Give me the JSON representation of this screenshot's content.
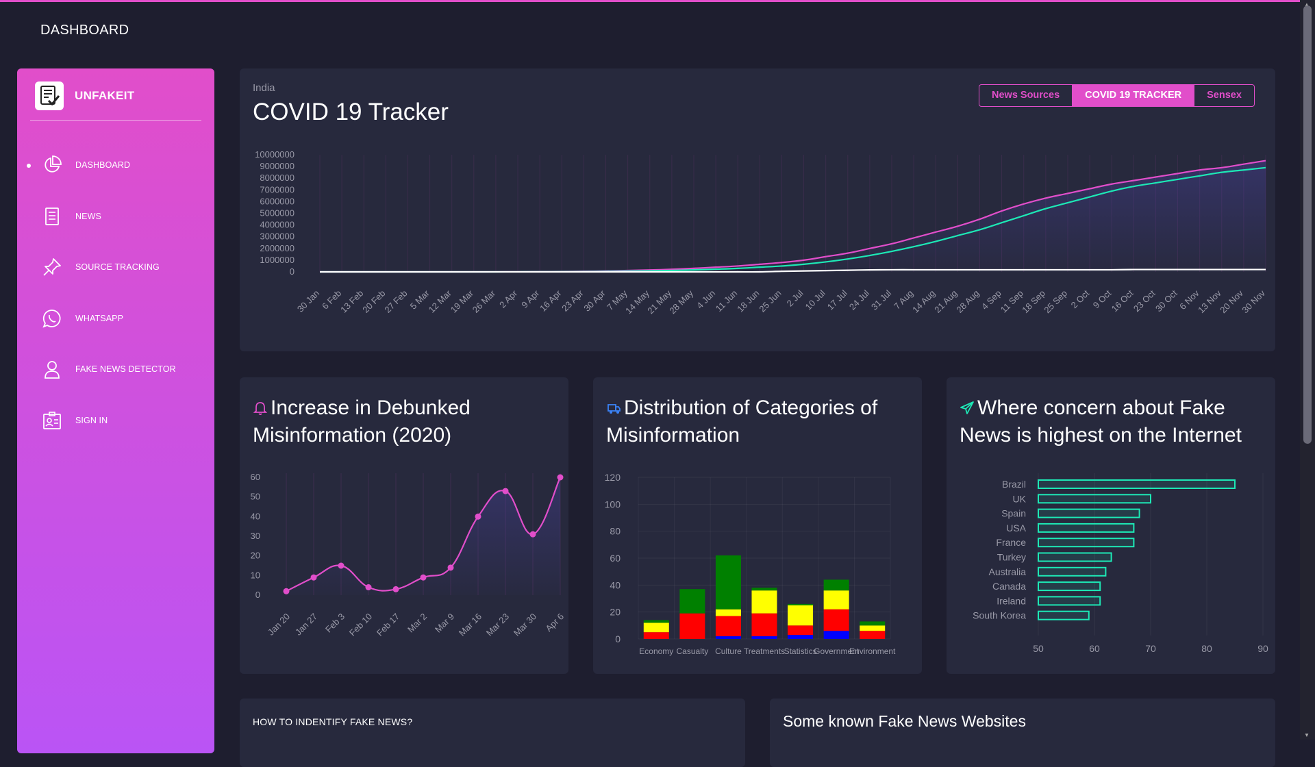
{
  "page_title": "DASHBOARD",
  "brand": {
    "name": "UNFAKEIT",
    "logo_icon": "checklist-icon"
  },
  "sidebar": {
    "items": [
      {
        "label": "DASHBOARD",
        "icon": "pie-chart-icon",
        "active": true
      },
      {
        "label": "NEWS",
        "icon": "document-icon",
        "active": false
      },
      {
        "label": "SOURCE TRACKING",
        "icon": "pin-icon",
        "active": false
      },
      {
        "label": "WHATSAPP",
        "icon": "whatsapp-icon",
        "active": false
      },
      {
        "label": "FAKE NEWS DETECTOR",
        "icon": "user-icon",
        "active": false
      },
      {
        "label": "SIGN IN",
        "icon": "badge-icon",
        "active": false
      }
    ]
  },
  "covid_card": {
    "subtitle": "India",
    "title": "COVID 19 Tracker",
    "tabs": [
      {
        "label": "News Sources",
        "active": false
      },
      {
        "label": "COVID 19 TRACKER",
        "active": true
      },
      {
        "label": "Sensex",
        "active": false
      }
    ]
  },
  "debunked_card": {
    "title": "Increase in Debunked Misinformation (2020)",
    "icon": "bell-icon"
  },
  "categories_card": {
    "title": "Distribution of Categories of Misinformation",
    "icon": "delivery-truck-icon"
  },
  "concern_card": {
    "title": "Where concern about Fake News is highest on the Internet",
    "icon": "send-icon"
  },
  "bottom": {
    "left_title": "HOW TO INDENTIFY FAKE NEWS?",
    "right_title": "Some known Fake News Websites"
  },
  "colors": {
    "accent": "#e14eca",
    "teal": "#1de9b6",
    "card_bg": "#27293d",
    "page_bg": "#1e1e2f"
  },
  "chart_data": [
    {
      "type": "line",
      "x_labels": [
        "30 Jan",
        "6 Feb",
        "13 Feb",
        "20 Feb",
        "27 Feb",
        "5 Mar",
        "12 Mar",
        "19 Mar",
        "26 Mar",
        "2 Apr",
        "9 Apr",
        "16 Apr",
        "23 Apr",
        "30 Apr",
        "7 May",
        "14 May",
        "21 May",
        "28 May",
        "4 Jun",
        "11 Jun",
        "18 Jun",
        "25 Jun",
        "2 Jul",
        "10 Jul",
        "17 Jul",
        "24 Jul",
        "31 Jul",
        "7 Aug",
        "14 Aug",
        "21 Aug",
        "28 Aug",
        "4 Sep",
        "11 Sep",
        "18 Sep",
        "25 Sep",
        "2 Oct",
        "9 Oct",
        "16 Oct",
        "23 Oct",
        "30 Oct",
        "6 Nov",
        "13 Nov",
        "20 Nov",
        "30 Nov"
      ],
      "y_ticks": [
        0,
        1000000,
        2000000,
        3000000,
        4000000,
        5000000,
        6000000,
        7000000,
        8000000,
        9000000,
        10000000
      ],
      "ylim": [
        0,
        10000000
      ],
      "series": [
        {
          "color": "#e14eca",
          "values": [
            0,
            0,
            0,
            0,
            0,
            0,
            0,
            0,
            5000,
            10000,
            20000,
            30000,
            50000,
            80000,
            120000,
            160000,
            220000,
            300000,
            400000,
            500000,
            650000,
            800000,
            1000000,
            1300000,
            1600000,
            2000000,
            2400000,
            2900000,
            3400000,
            3900000,
            4500000,
            5200000,
            5800000,
            6300000,
            6700000,
            7100000,
            7500000,
            7800000,
            8100000,
            8400000,
            8700000,
            8900000,
            9200000,
            9500000
          ]
        },
        {
          "color": "#1de9b6",
          "values": [
            0,
            0,
            0,
            0,
            0,
            0,
            0,
            0,
            2000,
            5000,
            10000,
            15000,
            25000,
            40000,
            60000,
            90000,
            120000,
            170000,
            230000,
            300000,
            400000,
            500000,
            650000,
            850000,
            1100000,
            1400000,
            1750000,
            2150000,
            2600000,
            3100000,
            3600000,
            4200000,
            4800000,
            5400000,
            5900000,
            6400000,
            6900000,
            7300000,
            7600000,
            7900000,
            8200000,
            8500000,
            8700000,
            8900000
          ]
        },
        {
          "color": "#ffffff",
          "values": [
            0,
            0,
            0,
            0,
            0,
            0,
            0,
            0,
            0,
            0,
            0,
            0,
            0,
            0,
            0,
            0,
            0,
            0,
            0,
            0,
            0,
            50000,
            80000,
            110000,
            140000,
            170000,
            180000,
            180000,
            180000,
            180000,
            180000,
            180000,
            180000,
            180000,
            180000,
            180000,
            180000,
            200000,
            200000,
            200000,
            200000,
            200000,
            200000,
            200000
          ]
        }
      ]
    },
    {
      "type": "line",
      "categories": [
        "Jan 20",
        "Jan 27",
        "Feb 3",
        "Feb 10",
        "Feb 17",
        "Mar 2",
        "Mar 9",
        "Mar 16",
        "Mar 23",
        "Mar 30",
        "Apr 6"
      ],
      "y_ticks": [
        0,
        10,
        20,
        30,
        40,
        50,
        60
      ],
      "ylim": [
        0,
        60
      ],
      "series": [
        {
          "color": "#e14eca",
          "values": [
            2,
            9,
            15,
            4,
            3,
            9,
            14,
            40,
            53,
            31,
            60
          ]
        }
      ]
    },
    {
      "type": "bar",
      "categories": [
        "Economy",
        "Casualty",
        "Culture",
        "Treatments",
        "Statistics",
        "Government",
        "Environment"
      ],
      "y_ticks": [
        0,
        20,
        40,
        60,
        80,
        100,
        120
      ],
      "ylim": [
        0,
        120
      ],
      "stacked": true,
      "series": [
        {
          "color": "#0000ff",
          "values": [
            0,
            0,
            2,
            2,
            3,
            6,
            0
          ]
        },
        {
          "color": "#ff0000",
          "values": [
            5,
            19,
            15,
            17,
            7,
            16,
            6
          ]
        },
        {
          "color": "#ffff00",
          "values": [
            7,
            0,
            5,
            17,
            15,
            14,
            4
          ]
        },
        {
          "color": "#008000",
          "values": [
            2,
            18,
            40,
            2,
            1,
            8,
            3
          ]
        }
      ]
    },
    {
      "type": "bar",
      "orientation": "horizontal",
      "categories": [
        "Brazil",
        "UK",
        "Spain",
        "USA",
        "France",
        "Turkey",
        "Australia",
        "Canada",
        "Ireland",
        "South Korea"
      ],
      "values": [
        85,
        70,
        68,
        67,
        67,
        63,
        62,
        61,
        61,
        59
      ],
      "x_ticks": [
        50,
        60,
        70,
        80,
        90
      ],
      "xlim": [
        50,
        90
      ],
      "color": "#1de9b6"
    }
  ]
}
